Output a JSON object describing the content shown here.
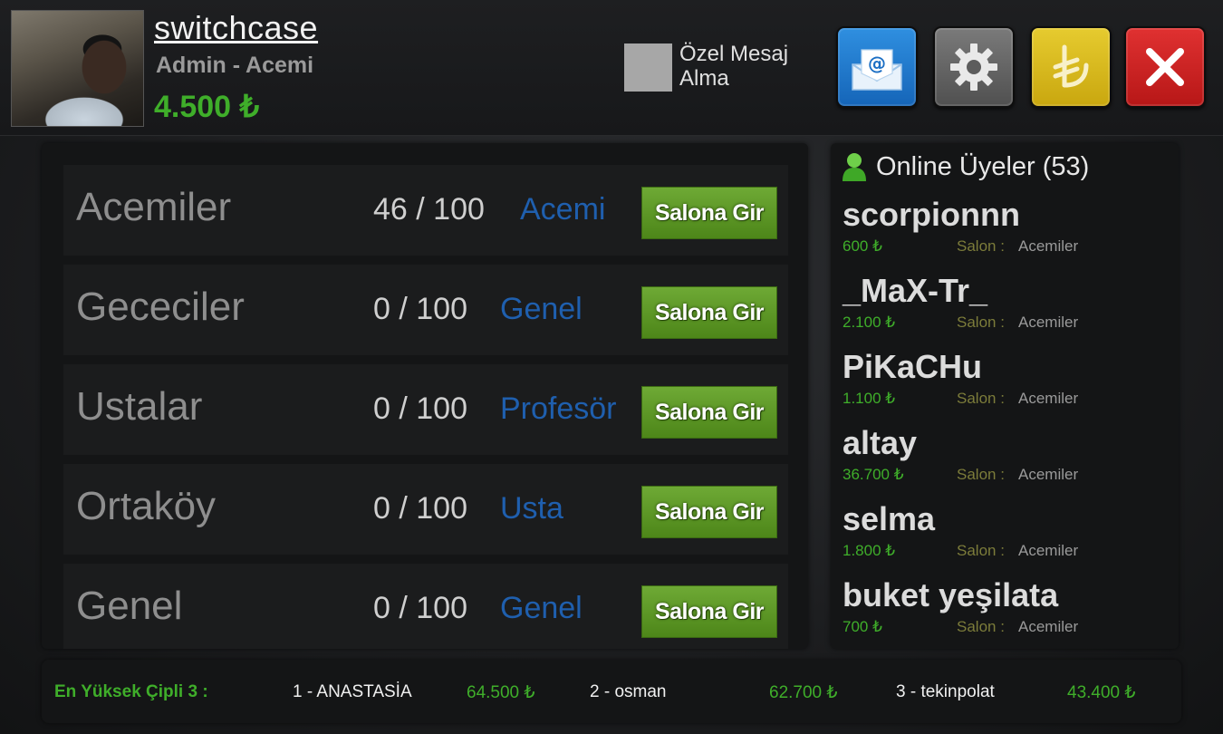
{
  "user": {
    "name": "switchcase",
    "role": "Admin - Acemi",
    "balance": "4.500 ₺"
  },
  "private_message": {
    "label_line1": "Özel Mesaj",
    "label_line2": "Alma"
  },
  "toolbar": {
    "icons": [
      "mail-icon",
      "gear-icon",
      "lira-icon",
      "close-icon"
    ],
    "colors": {
      "mail": "#1e78cc",
      "gear": "#666666",
      "coin": "#d9b91c",
      "close": "#cc2222"
    }
  },
  "rooms": [
    {
      "name": "Acemiler",
      "count": "46 / 100",
      "level": "Acemi",
      "button": "Salona Gir"
    },
    {
      "name": "Gececiler",
      "count": "0 / 100",
      "level": "Genel",
      "button": "Salona Gir"
    },
    {
      "name": "Ustalar",
      "count": "0 / 100",
      "level": "Profesör",
      "button": "Salona Gir"
    },
    {
      "name": "Ortaköy",
      "count": "0 / 100",
      "level": "Usta",
      "button": "Salona Gir"
    },
    {
      "name": "Genel",
      "count": "0 / 100",
      "level": "Genel",
      "button": "Salona Gir"
    }
  ],
  "online": {
    "title": "Online Üyeler (53)",
    "salon_label": "Salon :",
    "users": [
      {
        "name": "scorpionnn",
        "balance": "600 ₺",
        "salon": "Acemiler"
      },
      {
        "name": "_MaX-Tr_",
        "balance": "2.100 ₺",
        "salon": "Acemiler"
      },
      {
        "name": "PiKaCHu",
        "balance": "1.100 ₺",
        "salon": "Acemiler"
      },
      {
        "name": "altay",
        "balance": "36.700 ₺",
        "salon": "Acemiler"
      },
      {
        "name": "selma",
        "balance": "1.800 ₺",
        "salon": "Acemiler"
      },
      {
        "name": "buket yeşilata",
        "balance": "700 ₺",
        "salon": "Acemiler"
      }
    ]
  },
  "leaderboard": {
    "title": "En Yüksek Çipli 3 :",
    "entries": [
      {
        "name": "1 - ANASTASİA",
        "value": "64.500 ₺"
      },
      {
        "name": "2 - osman",
        "value": "62.700 ₺"
      },
      {
        "name": "3 - tekinpolat",
        "value": "43.400 ₺"
      }
    ]
  },
  "colors": {
    "green": "#3fae2a",
    "level_blue": "#1f5fae",
    "button_green": "#5e9a28"
  }
}
